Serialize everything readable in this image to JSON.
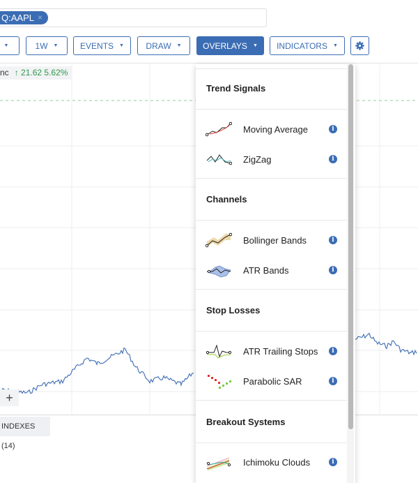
{
  "search": {
    "chip_label": "Q:AAPL",
    "chip_close": "×"
  },
  "toolbar": {
    "buttons": [
      {
        "label": ""
      },
      {
        "label": "1W"
      },
      {
        "label": "EVENTS"
      },
      {
        "label": "DRAW"
      },
      {
        "label": "OVERLAYS"
      },
      {
        "label": "INDICATORS"
      }
    ],
    "settings_icon": "gear-icon",
    "active": "OVERLAYS"
  },
  "chart": {
    "symbol_label": "nc",
    "change": "↑ 21.62",
    "change_pct": "5.62%",
    "plus": "+",
    "indexes": "INDEXES (14)",
    "line_color": "#4a76b8",
    "up_color": "#2c9a4a"
  },
  "overlays_menu": {
    "sections": [
      {
        "title": "Trend Signals",
        "items": [
          {
            "label": "Moving Average",
            "icon": "moving-average-icon"
          },
          {
            "label": "ZigZag",
            "icon": "zigzag-icon"
          }
        ]
      },
      {
        "title": "Channels",
        "items": [
          {
            "label": "Bollinger Bands",
            "icon": "bollinger-bands-icon"
          },
          {
            "label": "ATR Bands",
            "icon": "atr-bands-icon"
          }
        ]
      },
      {
        "title": "Stop Losses",
        "items": [
          {
            "label": "ATR Trailing Stops",
            "icon": "atr-trailing-stops-icon"
          },
          {
            "label": "Parabolic SAR",
            "icon": "parabolic-sar-icon"
          }
        ]
      },
      {
        "title": "Breakout Systems",
        "items": [
          {
            "label": "Ichimoku Clouds",
            "icon": "ichimoku-clouds-icon"
          }
        ]
      }
    ],
    "info_glyph": "i"
  },
  "accent": "#3b6db4"
}
